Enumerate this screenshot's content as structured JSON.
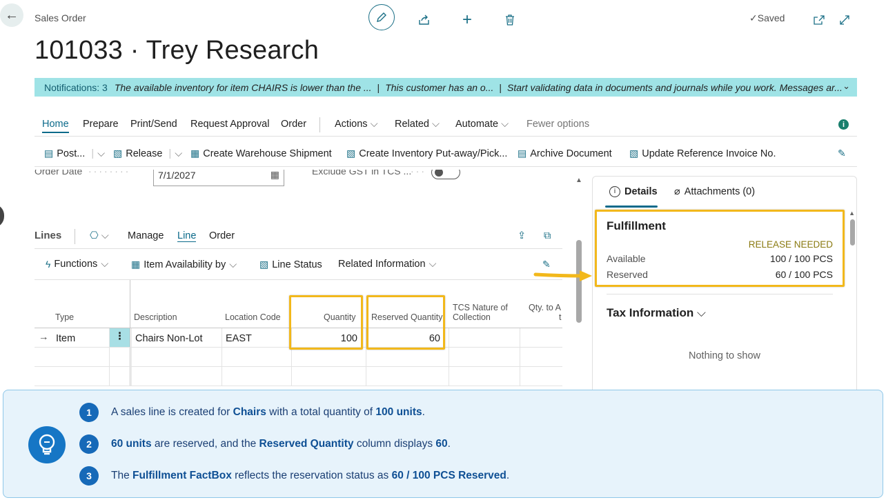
{
  "header": {
    "page_type": "Sales Order",
    "title": "101033 · Trey Research",
    "saved_label": "Saved"
  },
  "notifications": {
    "label": "Notifications: 3",
    "messages": [
      "The available inventory for item CHAIRS is lower than the ...",
      "This customer has an o...",
      "Start validating data in documents and journals while you work. Messages ar..."
    ]
  },
  "action_tabs": [
    {
      "label": "Home"
    },
    {
      "label": "Prepare"
    },
    {
      "label": "Print/Send"
    },
    {
      "label": "Request Approval"
    },
    {
      "label": "Order"
    },
    {
      "label": "Actions"
    },
    {
      "label": "Related"
    },
    {
      "label": "Automate"
    },
    {
      "label": "Fewer options"
    }
  ],
  "actions": [
    {
      "label": "Post..."
    },
    {
      "label": "Release"
    },
    {
      "label": "Create Warehouse Shipment"
    },
    {
      "label": "Create Inventory Put-away/Pick..."
    },
    {
      "label": "Archive Document"
    },
    {
      "label": "Update Reference Invoice No."
    }
  ],
  "fields": {
    "order_date_label": "Order Date",
    "order_date_value": "7/1/2027",
    "exclude_gst_label": "Exclude GST in TCS ..."
  },
  "lines": {
    "title": "Lines",
    "tabs": [
      "Manage",
      "Line",
      "Order"
    ],
    "actions": [
      "Functions",
      "Item Availability by",
      "Line Status",
      "Related Information"
    ],
    "columns": [
      "Type",
      "Description",
      "Location Code",
      "Quantity",
      "Reserved Quantity",
      "TCS Nature of",
      "Collection",
      "Qty. to A",
      "t"
    ],
    "row": {
      "type": "Item",
      "description": "Chairs Non-Lot",
      "location": "EAST",
      "quantity": "100",
      "reserved_quantity": "60"
    }
  },
  "factbox": {
    "tab_details": "Details",
    "tab_attachments": "Attachments (0)",
    "fulfillment_title": "Fulfillment",
    "status": "RELEASE NEEDED",
    "available_label": "Available",
    "available_value": "100 / 100 PCS",
    "reserved_label": "Reserved",
    "reserved_value": "60 / 100 PCS",
    "tax_title": "Tax Information",
    "empty_text": "Nothing to show"
  },
  "callout": {
    "steps": [
      {
        "num": "1",
        "t1": "A sales line is created for ",
        "b1": "Chairs",
        "t2": " with a total quantity of ",
        "b2": "100 units",
        "t3": "."
      },
      {
        "num": "2",
        "b0": "60 units",
        "t1": " are reserved, and the ",
        "b1": "Reserved Quantity",
        "t2": " column displays ",
        "b2": "60",
        "t3": "."
      },
      {
        "num": "3",
        "t1": "The ",
        "b1": "Fulfillment FactBox",
        "t2": " reflects the reservation status as ",
        "b2": "60 / 100 PCS Reserved",
        "t3": "."
      }
    ]
  },
  "colors": {
    "accent": "#0b6a8a",
    "notification_bg": "#9fe3e6",
    "highlight": "#f2b81b",
    "callout_bg": "#e7f3fb",
    "step_badge": "#1669b8"
  }
}
